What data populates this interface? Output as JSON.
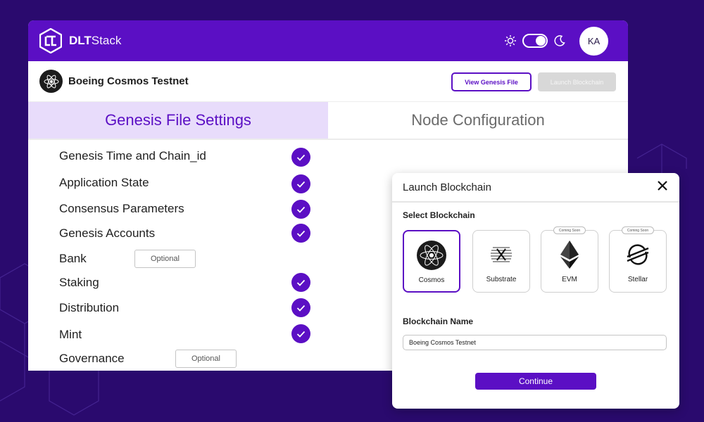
{
  "app": {
    "brand_bold": "DLT",
    "brand_rest": "Stack",
    "avatar_initials": "KA"
  },
  "project": {
    "name": "Boeing Cosmos Testnet",
    "view_genesis_label": "View Genesis File",
    "launch_label": "Launch Blockchain"
  },
  "tabs": [
    {
      "label": "Genesis File Settings",
      "active": true
    },
    {
      "label": "Node Configuration",
      "active": false
    }
  ],
  "settings": [
    {
      "label": "Genesis Time and Chain_id",
      "status": "check"
    },
    {
      "label": "Application State",
      "status": "check"
    },
    {
      "label": "Consensus Parameters",
      "status": "check"
    },
    {
      "label": "Genesis Accounts",
      "status": "check"
    },
    {
      "label": "Bank",
      "status": "Optional"
    },
    {
      "label": "Staking",
      "status": "check"
    },
    {
      "label": "Distribution",
      "status": "check"
    },
    {
      "label": "Mint",
      "status": "check"
    },
    {
      "label": "Governance",
      "status": "Optional"
    }
  ],
  "modal": {
    "title": "Launch Blockchain",
    "select_label": "Select Blockchain",
    "blockchains": [
      {
        "name": "Cosmos",
        "icon": "cosmos-icon",
        "selected": true,
        "badge": ""
      },
      {
        "name": "Substrate",
        "icon": "substrate-icon",
        "selected": false,
        "badge": ""
      },
      {
        "name": "EVM",
        "icon": "ethereum-icon",
        "selected": false,
        "badge": "Coming Soon"
      },
      {
        "name": "Stellar",
        "icon": "stellar-icon",
        "selected": false,
        "badge": "Coming Soon"
      }
    ],
    "name_label": "Blockchain Name",
    "name_value": "Boeing Cosmos Testnet",
    "continue_label": "Continue"
  },
  "colors": {
    "accent": "#5b0fc4",
    "background": "#2a0a6e",
    "tab_active_bg": "#e8dcfb"
  }
}
